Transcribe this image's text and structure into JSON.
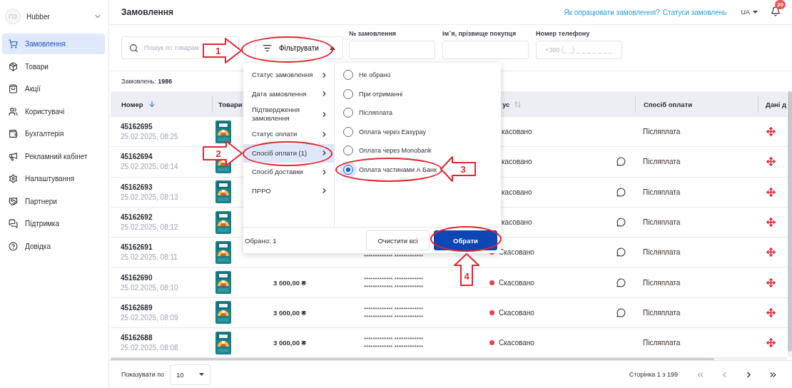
{
  "sidebar": {
    "account": {
      "initials": "ПЗ",
      "name": "Hubber"
    },
    "items": [
      {
        "label": "Замовлення",
        "selected": true
      },
      {
        "label": "Товари",
        "selected": false
      },
      {
        "label": "Акції",
        "selected": false
      },
      {
        "label": "Користувачі",
        "selected": false
      },
      {
        "label": "Бухгалтерія",
        "selected": false
      },
      {
        "label": "Рекламний кабінет",
        "selected": false
      },
      {
        "label": "Налаштування",
        "selected": false
      },
      {
        "label": "Партнери",
        "selected": false
      },
      {
        "label": "Підтримка",
        "selected": false
      },
      {
        "label": "Довідка",
        "selected": false
      }
    ]
  },
  "header": {
    "title": "Замовлення",
    "links": [
      "Як опрацювати замовлення?",
      "Статуси замовлень"
    ],
    "language": "UA",
    "notifications": "20"
  },
  "filters": {
    "search_placeholder": "Пошук по товарам",
    "filter_button": "Фільтрувати",
    "fields": [
      {
        "label": "№ замовлення"
      },
      {
        "label": "Ім`я, прізвище покупця"
      },
      {
        "label": "Номер телефону",
        "placeholder": "+380 (_ _) _ _ _ _ _ _ _"
      }
    ]
  },
  "orders_count": {
    "label": "Замовлень:",
    "value": "1986"
  },
  "table": {
    "columns": [
      {
        "label": "Номер"
      },
      {
        "label": "Товари"
      },
      {
        "label": "ус"
      },
      {
        "label": "Спосіб оплати"
      },
      {
        "label": "Дані д"
      }
    ],
    "rows": [
      {
        "number": "45162695",
        "date": "25.02.2025, 08:25",
        "status": "касовано",
        "comment": false,
        "payment": "Післяплата"
      },
      {
        "number": "45162694",
        "date": "25.02.2025, 08:14",
        "status": "касовано",
        "comment": true,
        "payment": "Післяплата"
      },
      {
        "number": "45162693",
        "date": "25.02.2025, 08:13",
        "status": "касовано",
        "comment": true,
        "payment": "Післяплата"
      },
      {
        "number": "45162692",
        "date": "25.02.2025, 08:12",
        "status": "касовано",
        "comment": true,
        "payment": "Післяплата"
      },
      {
        "number": "45162691",
        "date": "25.02.2025, 08:11",
        "names": [
          "************* *************"
        ],
        "status": "Скасовано",
        "status_dot": true,
        "comment": true,
        "payment": "Післяплата"
      },
      {
        "number": "45162690",
        "date": "25.02.2025, 08:10",
        "price": "3 000,00 ₴",
        "names": [
          "************* *************",
          "************* *************"
        ],
        "status": "Скасовано",
        "status_dot": true,
        "comment": true,
        "payment": "Післяплата"
      },
      {
        "number": "45162689",
        "date": "25.02.2025, 08:09",
        "price": "3 000,00 ₴",
        "names": [
          "************* *************",
          "************* *************"
        ],
        "status": "Скасовано",
        "status_dot": true,
        "comment": true,
        "payment": "Післяплата"
      },
      {
        "number": "45162688",
        "date": "25.02.2025, 08:08",
        "price": "3 000,00 ₴",
        "names": [
          "************* *************",
          "************* *************"
        ],
        "status": "Скасовано",
        "status_dot": true,
        "comment": false,
        "payment": "Післяплата"
      }
    ]
  },
  "filter_menu": {
    "categories": [
      {
        "label": "Статус замовлення",
        "selected": false
      },
      {
        "label": "Дата замовлення",
        "selected": false
      },
      {
        "label": "Підтвердження замовлення",
        "selected": false
      },
      {
        "label": "Статус оплати",
        "selected": false
      },
      {
        "label": "Спосіб оплати (1)",
        "selected": true
      },
      {
        "label": "Спосіб доставки",
        "selected": false
      },
      {
        "label": "ПРРО",
        "selected": false
      }
    ],
    "options": [
      {
        "label": "Не обрано",
        "selected": false
      },
      {
        "label": "При отриманні",
        "selected": false
      },
      {
        "label": "Післяплата",
        "selected": false
      },
      {
        "label": "Оплата через Easypay",
        "selected": false
      },
      {
        "label": "Оплата через Monobank",
        "selected": false
      },
      {
        "label": "Оплата частинами А Банк",
        "selected": true
      }
    ],
    "selected_count": "Обрано: 1",
    "clear_button": "Очистити всі",
    "apply_button": "Обрати"
  },
  "pagination": {
    "page_size_label": "Показувати по",
    "page_size": "10",
    "page_info": "Сторінка 1 з 199"
  },
  "annotations": [
    {
      "kind": "ring"
    },
    {
      "kind": "arrow",
      "number": "1"
    },
    {
      "kind": "ring"
    },
    {
      "kind": "arrow",
      "number": "2"
    },
    {
      "kind": "ring"
    },
    {
      "kind": "arrow",
      "number": "3"
    },
    {
      "kind": "ring"
    },
    {
      "kind": "arrow",
      "number": "4"
    }
  ]
}
